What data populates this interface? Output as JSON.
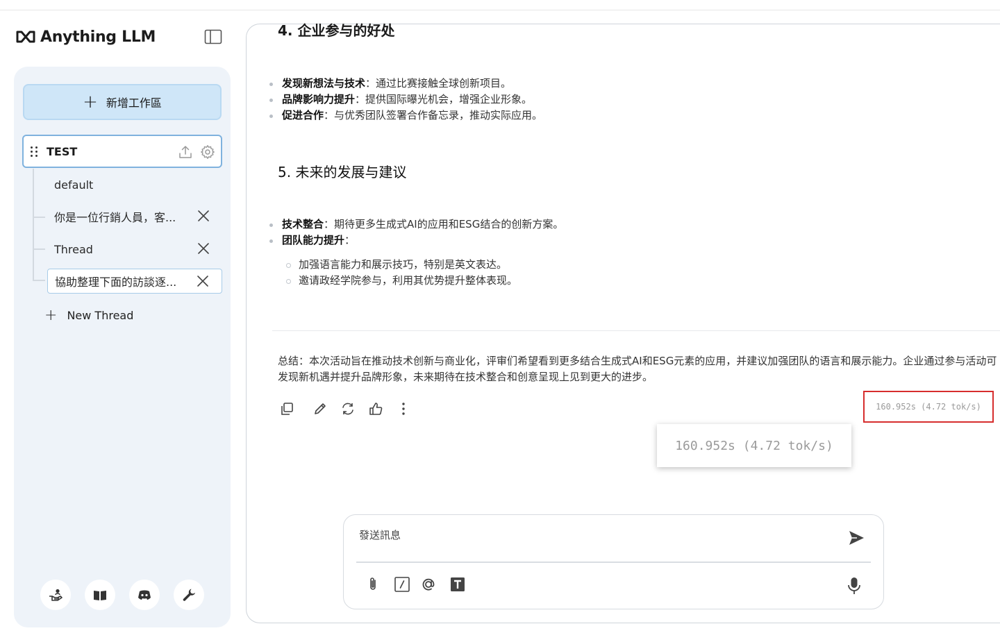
{
  "app": {
    "brand": "Anything LLM"
  },
  "sidebar": {
    "new_workspace_label": "新增工作區",
    "workspace": {
      "name": "TEST"
    },
    "threads": [
      {
        "label": "default",
        "closable": false,
        "active": false
      },
      {
        "label": "你是一位行銷人員，客...",
        "closable": true,
        "active": false
      },
      {
        "label": "Thread",
        "closable": true,
        "active": false
      },
      {
        "label": "協助整理下面的訪談逐...",
        "closable": true,
        "active": true
      }
    ],
    "new_thread_label": "New Thread",
    "footer_icons": [
      "community-icon",
      "docs-book-icon",
      "discord-icon",
      "settings-wrench-icon"
    ]
  },
  "chat": {
    "section4_heading": "4. 企业参与的好处",
    "section4_items": [
      {
        "bold": "发现新想法与技术",
        "text": "：通过比赛接触全球创新项目。"
      },
      {
        "bold": "品牌影响力提升",
        "text": "：提供国际曝光机会，增强企业形象。"
      },
      {
        "bold": "促进合作",
        "text": "：与优秀团队签署合作备忘录，推动实际应用。"
      }
    ],
    "section5_heading": "5. 未来的发展与建议",
    "section5_items": [
      {
        "bold": "技术整合",
        "text": "：期待更多生成式AI的应用和ESG结合的创新方案。"
      },
      {
        "bold": "团队能力提升",
        "text": "："
      }
    ],
    "section5_subitems": [
      "加强语言能力和展示技巧，特别是英文表达。",
      "邀请政经学院参与，利用其优势提升整体表现。"
    ],
    "summary": "总结：本次活动旨在推动技术创新与商业化，评审们希望看到更多结合生成式AI和ESG元素的应用，并建议加强团队的语言和展示能力。企业通过参与活动可发现新机遇并提升品牌形象，未来期待在技术整合和创意呈现上见到更大的进步。",
    "metrics_text": "160.952s (4.72 tok/s)",
    "metrics_zoom_text": "160.952s (4.72 tok/s)"
  },
  "composer": {
    "placeholder": "發送訊息"
  },
  "colors": {
    "accent": "#cfe6f8",
    "highlight_border": "#d62d2d",
    "sidebar_bg": "#eef3f9"
  }
}
